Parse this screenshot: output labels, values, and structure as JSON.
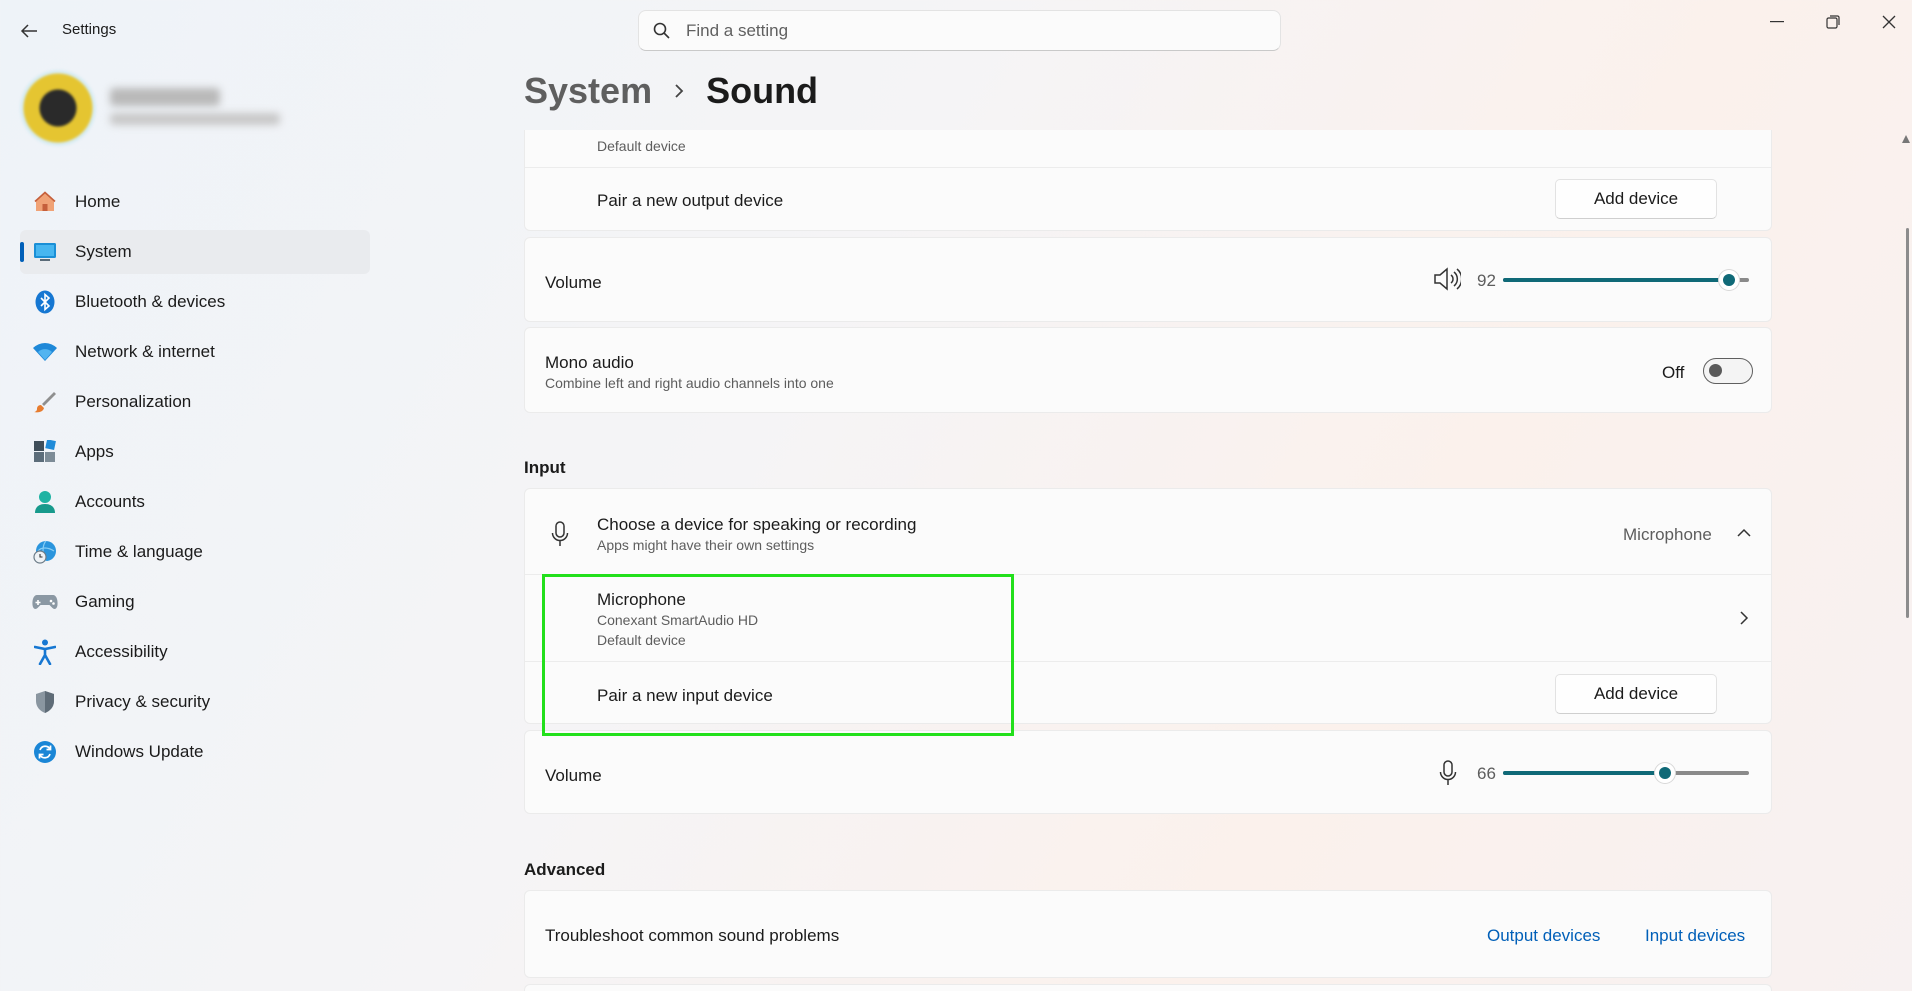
{
  "app": {
    "title": "Settings"
  },
  "search": {
    "placeholder": "Find a setting"
  },
  "sidebar": {
    "items": [
      {
        "label": "Home",
        "icon": "home-icon"
      },
      {
        "label": "System",
        "icon": "system-icon",
        "active": true
      },
      {
        "label": "Bluetooth & devices",
        "icon": "bluetooth-icon"
      },
      {
        "label": "Network & internet",
        "icon": "wifi-icon"
      },
      {
        "label": "Personalization",
        "icon": "brush-icon"
      },
      {
        "label": "Apps",
        "icon": "apps-icon"
      },
      {
        "label": "Accounts",
        "icon": "person-icon"
      },
      {
        "label": "Time & language",
        "icon": "globe-clock-icon"
      },
      {
        "label": "Gaming",
        "icon": "gamepad-icon"
      },
      {
        "label": "Accessibility",
        "icon": "accessibility-icon"
      },
      {
        "label": "Privacy & security",
        "icon": "shield-icon"
      },
      {
        "label": "Windows Update",
        "icon": "update-icon"
      }
    ]
  },
  "header": {
    "parent": "System",
    "current": "Sound"
  },
  "output": {
    "default_device_label": "Default device",
    "pair_label": "Pair a new output device",
    "add_button": "Add device",
    "volume_label": "Volume",
    "volume_value": "92",
    "volume_percent": 92,
    "mono": {
      "title": "Mono audio",
      "description": "Combine left and right audio channels into one",
      "state": "Off"
    }
  },
  "input": {
    "section_title": "Input",
    "choose": {
      "title": "Choose a device for speaking or recording",
      "description": "Apps might have their own settings",
      "selected": "Microphone"
    },
    "device": {
      "name": "Microphone",
      "driver": "Conexant SmartAudio HD",
      "status": "Default device"
    },
    "pair_label": "Pair a new input device",
    "add_button": "Add device",
    "volume_label": "Volume",
    "volume_value": "66",
    "volume_percent": 66
  },
  "advanced": {
    "section_title": "Advanced",
    "troubleshoot": {
      "title": "Troubleshoot common sound problems",
      "output_link": "Output devices",
      "input_link": "Input devices"
    }
  },
  "colors": {
    "accent": "#0f6977",
    "link": "#005fb8",
    "highlight": "#22e01b"
  }
}
